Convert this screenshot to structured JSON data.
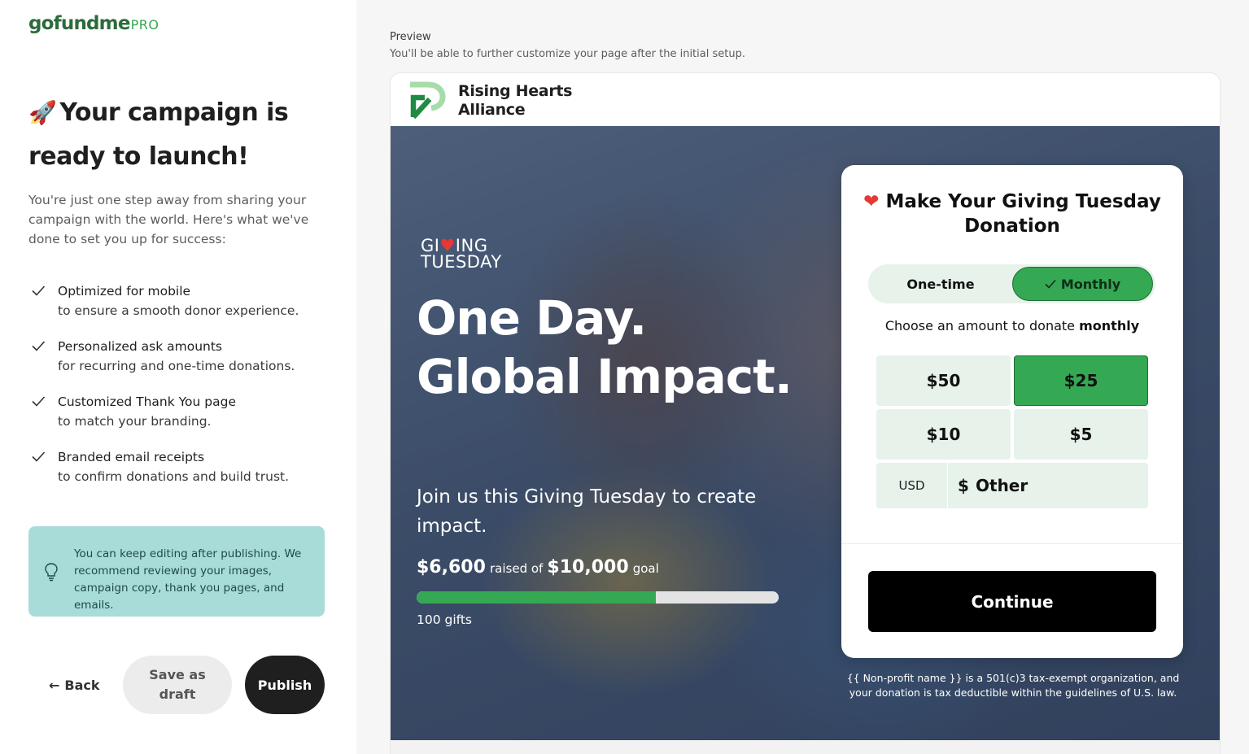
{
  "brand": {
    "logo_text": "gofundme",
    "logo_suffix": "PRO"
  },
  "left": {
    "headline": "Your campaign is ready to launch!",
    "intro": "You're just one step away from sharing your campaign with the world. Here's what we've done to set you up for success:",
    "features": [
      {
        "title": "Optimized for mobile",
        "subtitle": "to ensure a smooth donor experience."
      },
      {
        "title": "Personalized ask amounts",
        "subtitle": "for recurring and one-time donations."
      },
      {
        "title": "Customized Thank You page",
        "subtitle": "to match your branding."
      },
      {
        "title": "Branded email receipts",
        "subtitle": "to confirm donations and build trust."
      }
    ],
    "tip": "You can keep editing after publishing. We recommend reviewing your images, campaign copy, thank you pages, and emails.",
    "back_label": "Back",
    "draft_label": "Save as draft",
    "publish_label": "Publish"
  },
  "preview": {
    "title": "Preview",
    "subtitle": "You'll be able to further customize your page after the initial setup.",
    "org_name": "Rising Hearts Alliance",
    "hero": {
      "badge_line1_a": "GI",
      "badge_line1_b": "ING",
      "badge_line2": "TUESDAY",
      "title": "One Day. Global Impact.",
      "subtitle": "Join us this Giving Tuesday to create impact.",
      "raised": "$6,600",
      "raised_of": "raised of",
      "goal": "$10,000",
      "goal_label": "goal",
      "progress_fraction": 0.66,
      "gifts": "100 gifts"
    },
    "donation": {
      "title": "Make Your Giving Tuesday Donation",
      "one_time_label": "One-time",
      "monthly_label": "Monthly",
      "choose_text": "Choose an amount to donate",
      "choose_bold": "monthly",
      "amounts": [
        "$50",
        "$25",
        "$10",
        "$5"
      ],
      "selected_amount": "$25",
      "currency": "USD",
      "currency_symbol": "$",
      "other_placeholder": "Other",
      "continue_label": "Continue"
    },
    "disclaimer": "{{ Non-profit name }} is a 501(c)3 tax-exempt organization, and your donation is tax deductible within the guidelines of U.S. law."
  },
  "colors": {
    "brand_green": "#35a853",
    "logo_green": "#2d6b3b",
    "tip_bg": "#a8dcd9",
    "publish_bg": "#1f1f1f",
    "heart_red": "#e53935"
  },
  "icons": {
    "rocket": "rocket-icon",
    "check": "check-icon",
    "bulb": "lightbulb-icon",
    "back": "arrow-left-icon",
    "heart": "heart-icon"
  }
}
